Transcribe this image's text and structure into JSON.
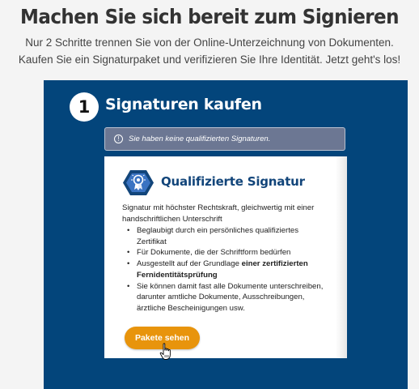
{
  "header": {
    "title": "Machen Sie sich bereit zum Signieren",
    "subtitle_line1": "Nur 2 Schritte trennen Sie von der Online-Unterzeichnung von Dokumenten.",
    "subtitle_line2": "Kaufen Sie ein Signaturpaket und verifizieren Sie Ihre Identität. Jetzt geht's los!"
  },
  "step": {
    "number": "1",
    "title": "Signaturen kaufen"
  },
  "alert": {
    "icon": "info-icon",
    "message": "Sie haben keine qualifizierten Signaturen."
  },
  "card": {
    "icon": "certificate-badge-icon",
    "title": "Qualifizierte Signatur",
    "description": "Signatur mit höchster Rechtskraft, gleichwertig mit einer handschriftlichen Unterschrift",
    "features": [
      "Beglaubigt durch ein persönliches qualifiziertes Zertifikat",
      "Für Dokumente, die der Schriftform bedürfen",
      "Sie können damit fast alle Dokumente unterschreiben, darunter amtliche Dokumente, Ausschreibungen, ärztliche Bescheinigungen usw."
    ],
    "feature3_prefix": "Ausgestellt auf der Grundlage ",
    "feature3_bold": "einer zertifizierten Fernidentitätsprüfung",
    "button_label": "Pakete sehen"
  },
  "colors": {
    "panel": "#03457b",
    "alert": "#6c7793",
    "title_blue": "#12457a",
    "button": "#e8940c"
  }
}
